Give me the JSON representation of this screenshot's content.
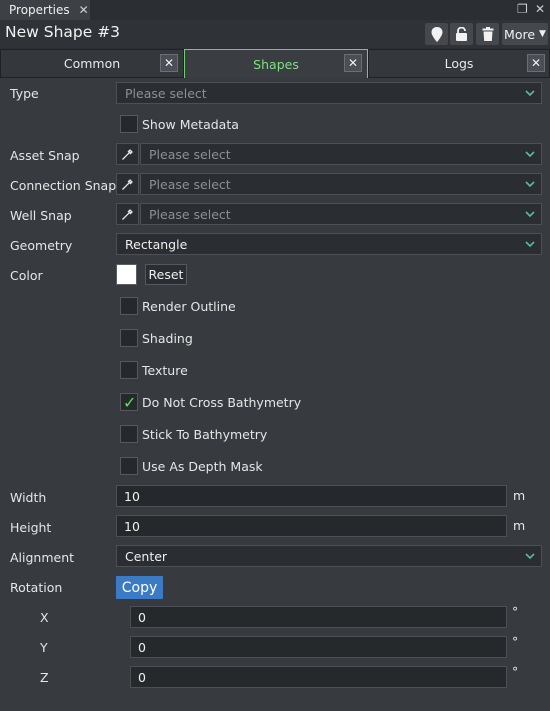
{
  "window": {
    "pane_tab_label": "Properties",
    "pane_tab_close": "✕",
    "restore_glyph": "❐",
    "close_glyph": "✕"
  },
  "header": {
    "title": "New Shape #3",
    "icons": [
      "pin-icon",
      "unlock-icon",
      "trash-icon"
    ],
    "more_label": "More",
    "more_arrow": "▼"
  },
  "tabs": [
    {
      "label": "Common",
      "close": "✕",
      "active": false
    },
    {
      "label": "Shapes",
      "close": "✕",
      "active": true
    },
    {
      "label": "Logs",
      "close": "✕",
      "active": false
    }
  ],
  "form": {
    "type": {
      "label": "Type",
      "placeholder": "Please select"
    },
    "show_metadata": {
      "label": "Show Metadata",
      "checked": false
    },
    "asset_snap": {
      "label": "Asset Snap",
      "placeholder": "Please select"
    },
    "connection_snap": {
      "label": "Connection Snap",
      "placeholder": "Please select"
    },
    "well_snap": {
      "label": "Well Snap",
      "placeholder": "Please select"
    },
    "geometry": {
      "label": "Geometry",
      "value": "Rectangle"
    },
    "color": {
      "label": "Color",
      "swatch": "#ffffff",
      "reset_label": "Reset"
    },
    "render_outline": {
      "label": "Render Outline",
      "checked": false
    },
    "shading": {
      "label": "Shading",
      "checked": false
    },
    "texture": {
      "label": "Texture",
      "checked": false
    },
    "do_not_cross_bathymetry": {
      "label": "Do Not Cross Bathymetry",
      "checked": true,
      "mark": "✓"
    },
    "stick_to_bathymetry": {
      "label": "Stick To Bathymetry",
      "checked": false
    },
    "use_as_depth_mask": {
      "label": "Use As Depth Mask",
      "checked": false
    },
    "width": {
      "label": "Width",
      "value": "10",
      "unit": "m"
    },
    "height": {
      "label": "Height",
      "value": "10",
      "unit": "m"
    },
    "alignment": {
      "label": "Alignment",
      "value": "Center"
    },
    "rotation": {
      "label": "Rotation",
      "copy_label": "Copy",
      "x": {
        "label": "X",
        "value": "0",
        "unit": "°"
      },
      "y": {
        "label": "Y",
        "value": "0",
        "unit": "°"
      },
      "z": {
        "label": "Z",
        "value": "0",
        "unit": "°"
      }
    }
  },
  "colors": {
    "accent_green": "#6fcf6f",
    "button_blue": "#3b7bc6",
    "background": "#373b40"
  }
}
